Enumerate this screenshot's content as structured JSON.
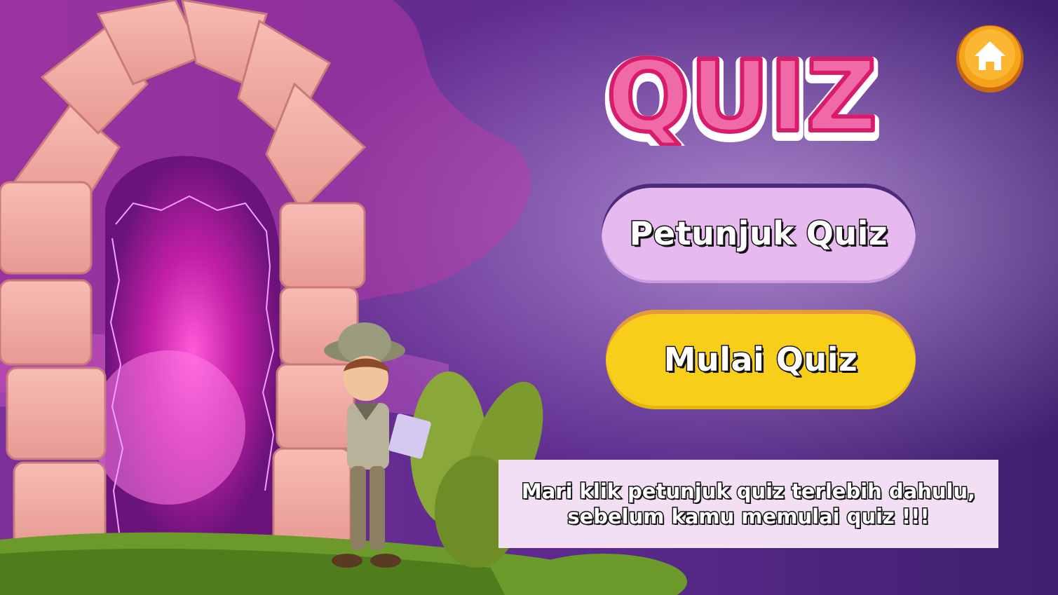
{
  "title": "QUIZ",
  "home_button": {
    "icon": "home-icon"
  },
  "buttons": {
    "petunjuk_label": "Petunjuk  Quiz",
    "mulai_label": "Mulai Quiz"
  },
  "info": {
    "line1": "Mari klik  petunjuk  quiz terlebih  dahulu,",
    "line2": "sebelum  kamu  memulai quiz !!!"
  },
  "colors": {
    "background": "#5a2a8e",
    "title_fill": "#f06aa8",
    "petunjuk_button": "#e6b9ef",
    "mulai_button": "#f7cf1a",
    "home_button": "#f7a21b",
    "info_box": "#f3dff3"
  }
}
